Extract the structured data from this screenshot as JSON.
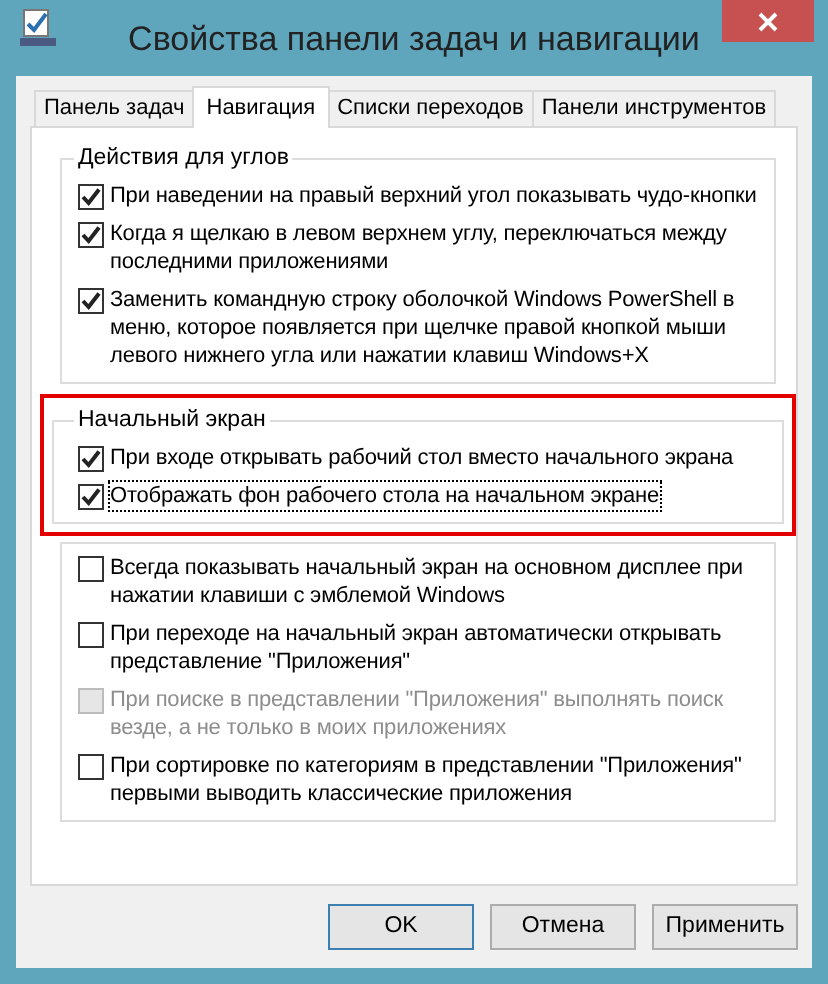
{
  "window": {
    "title": "Свойства панели задач и навигации"
  },
  "tabs": [
    {
      "label": "Панель задач",
      "selected": false
    },
    {
      "label": "Навигация",
      "selected": true
    },
    {
      "label": "Списки переходов",
      "selected": false
    },
    {
      "label": "Панели инструментов",
      "selected": false
    }
  ],
  "groups": [
    {
      "heading": "Действия для углов",
      "highlighted": false,
      "options": [
        {
          "label": "При наведении на правый верхний угол показывать чудо-кнопки",
          "checked": true,
          "disabled": false,
          "focused": false
        },
        {
          "label": "Когда я щелкаю в левом верхнем углу, переключаться между последними приложениями",
          "checked": true,
          "disabled": false,
          "focused": false
        },
        {
          "label": "Заменить командную строку оболочкой Windows PowerShell в меню, которое появляется при щелчке правой кнопкой мыши левого нижнего угла или нажатии клавиш Windows+X",
          "checked": true,
          "disabled": false,
          "focused": false
        }
      ]
    },
    {
      "heading": "Начальный экран",
      "highlighted": true,
      "options": [
        {
          "label": "При входе открывать рабочий стол вместо начального экрана",
          "checked": true,
          "disabled": false,
          "focused": false
        },
        {
          "label": "Отображать фон рабочего стола на начальном экране",
          "checked": true,
          "disabled": false,
          "focused": true
        }
      ]
    },
    {
      "highlighted": false,
      "options": [
        {
          "label": "Всегда показывать начальный экран на основном дисплее при нажатии клавиши с эмблемой Windows",
          "checked": false,
          "disabled": false,
          "focused": false
        },
        {
          "label": "При переходе на начальный экран автоматически открывать представление \"Приложения\"",
          "checked": false,
          "disabled": false,
          "focused": false
        },
        {
          "label": "При поиске в представлении \"Приложения\" выполнять поиск везде, а не только в моих приложениях",
          "checked": false,
          "disabled": true,
          "focused": false
        },
        {
          "label": "При сортировке по категориям в представлении \"Приложения\" первыми выводить классические приложения",
          "checked": false,
          "disabled": false,
          "focused": false
        }
      ]
    }
  ],
  "buttons": [
    {
      "label": "OK",
      "default": true
    },
    {
      "label": "Отмена",
      "default": false
    },
    {
      "label": "Применить",
      "default": false
    }
  ]
}
